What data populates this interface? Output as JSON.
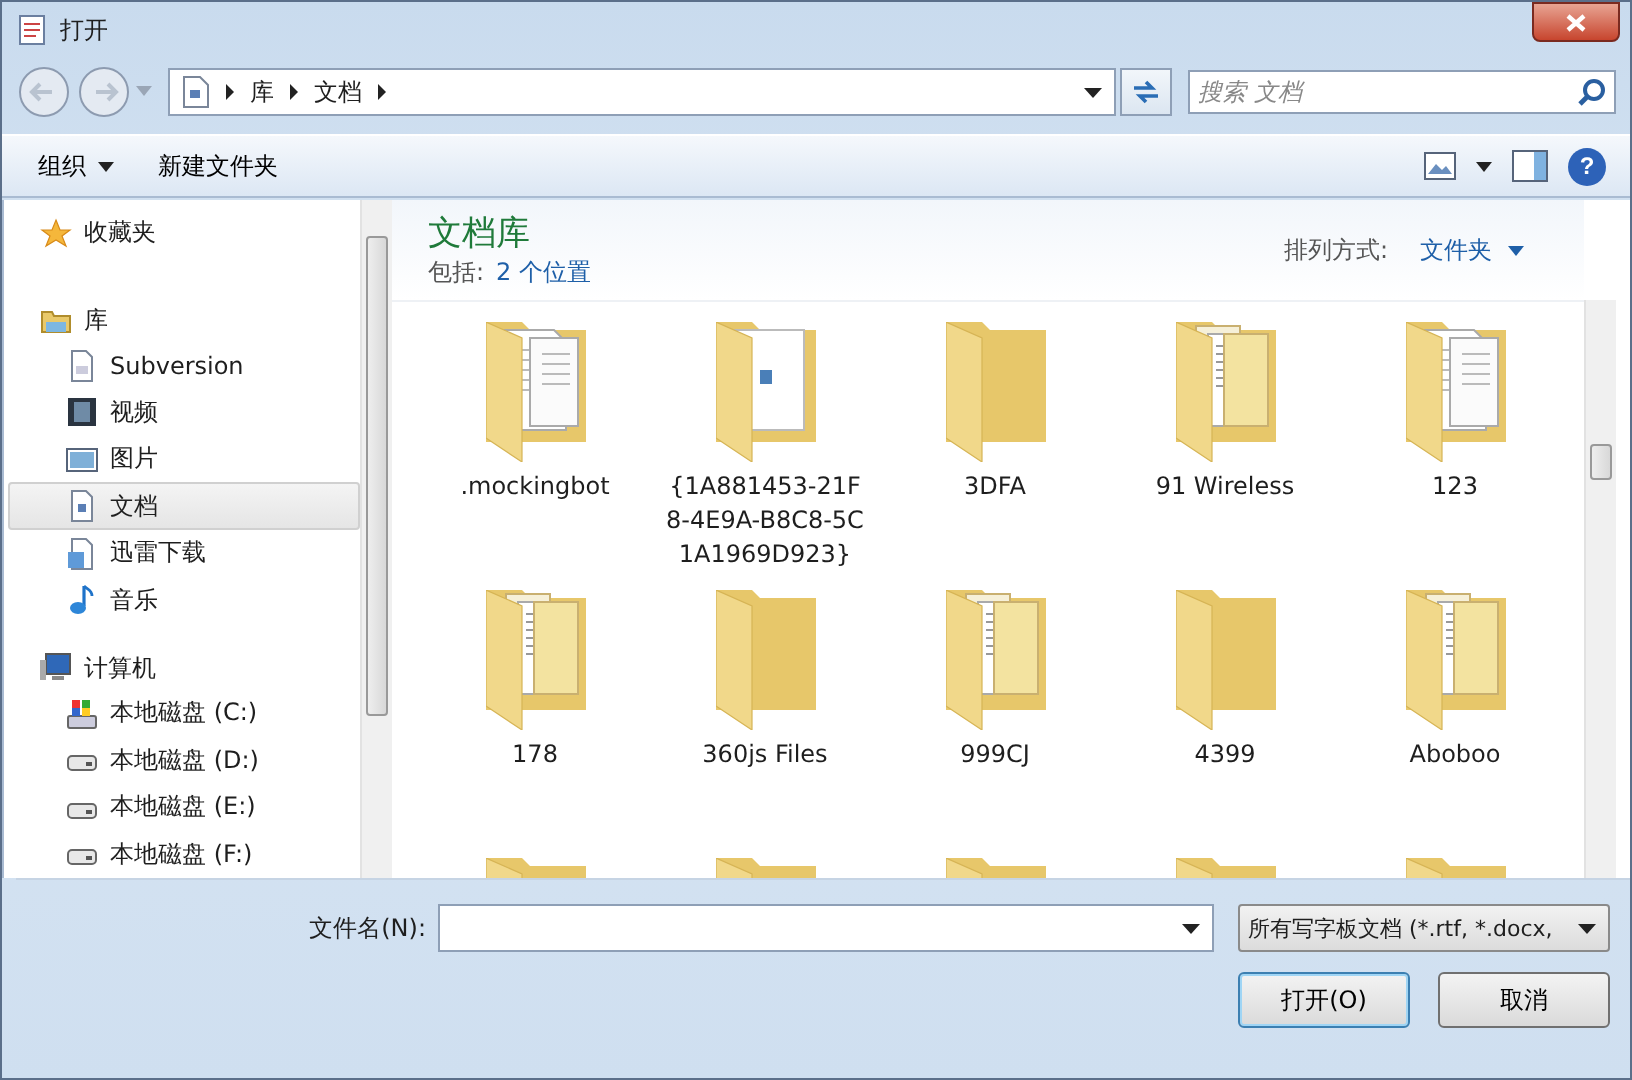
{
  "window": {
    "title": "打开"
  },
  "address_bar": {
    "segments": [
      "库",
      "文档"
    ]
  },
  "search": {
    "placeholder": "搜索 文档"
  },
  "toolbar": {
    "organize": "组织",
    "new_folder": "新建文件夹",
    "help": "?"
  },
  "sidebar": {
    "groups": [
      {
        "label": "收藏夹",
        "kind": "favorites"
      },
      {
        "label": "库",
        "kind": "library",
        "children": [
          {
            "label": "Subversion",
            "kind": "svn",
            "selected": false
          },
          {
            "label": "视频",
            "kind": "video",
            "selected": false
          },
          {
            "label": "图片",
            "kind": "picture",
            "selected": false
          },
          {
            "label": "文档",
            "kind": "document",
            "selected": true
          },
          {
            "label": "迅雷下载",
            "kind": "download",
            "selected": false
          },
          {
            "label": "音乐",
            "kind": "music",
            "selected": false
          }
        ]
      },
      {
        "label": "计算机",
        "kind": "computer",
        "children": [
          {
            "label": "本地磁盘 (C:)",
            "kind": "system-drive",
            "selected": false
          },
          {
            "label": "本地磁盘 (D:)",
            "kind": "drive",
            "selected": false
          },
          {
            "label": "本地磁盘 (E:)",
            "kind": "drive",
            "selected": false
          },
          {
            "label": "本地磁盘 (F:)",
            "kind": "drive",
            "selected": false
          }
        ]
      }
    ]
  },
  "library_header": {
    "title": "文档库",
    "includes_label": "包括:",
    "includes_link": "2 个位置",
    "arrange_label": "排列方式:",
    "arrange_value": "文件夹"
  },
  "folders": [
    {
      "name": ".mockingbot",
      "kind": "docs"
    },
    {
      "name": "{1A881453-21F8-4E9A-B8C8-5C1A1969D923}",
      "kind": "app"
    },
    {
      "name": "3DFA",
      "kind": "empty"
    },
    {
      "name": "91 Wireless",
      "kind": "files"
    },
    {
      "name": "123",
      "kind": "docs"
    },
    {
      "name": "178",
      "kind": "files"
    },
    {
      "name": "360js Files",
      "kind": "empty"
    },
    {
      "name": "999CJ",
      "kind": "files"
    },
    {
      "name": "4399",
      "kind": "empty"
    },
    {
      "name": "Aboboo",
      "kind": "files"
    },
    {
      "kind": "empty"
    },
    {
      "kind": "empty"
    },
    {
      "kind": "empty"
    },
    {
      "kind": "empty"
    },
    {
      "kind": "empty"
    }
  ],
  "footer": {
    "filename_label": "文件名(N):",
    "filter": "所有写字板文档 (*.rtf, *.docx,",
    "open_button": "打开(O)",
    "cancel_button": "取消"
  }
}
